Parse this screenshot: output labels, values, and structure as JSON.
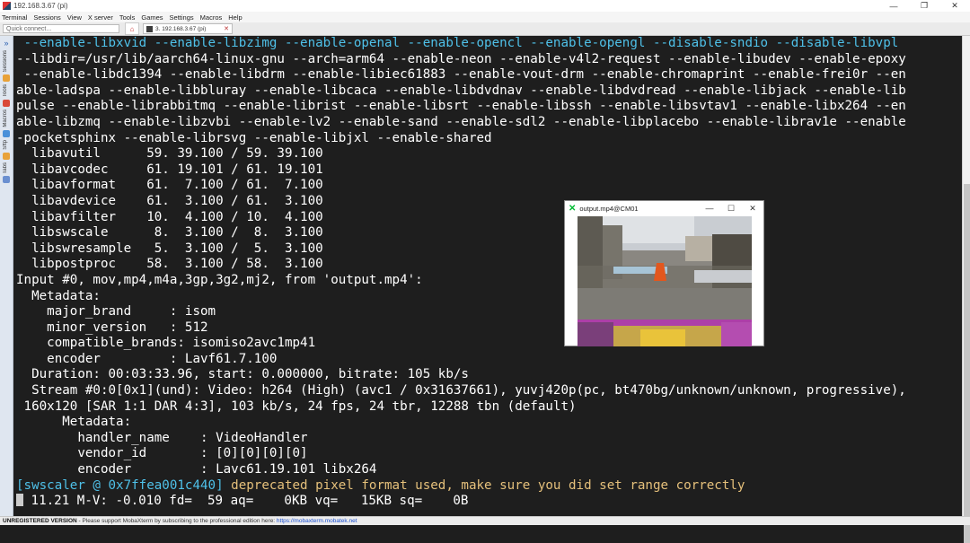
{
  "window": {
    "title": "192.168.3.67 (pi)",
    "controls": [
      "—",
      "❐",
      "✕"
    ]
  },
  "menu": [
    "Terminal",
    "Sessions",
    "View",
    "X server",
    "Tools",
    "Games",
    "Settings",
    "Macros",
    "Help"
  ],
  "quick_connect": {
    "placeholder": "Quick connect..."
  },
  "tab": {
    "label": "3. 192.168.3.67 (pi)",
    "close": "✕"
  },
  "sidebar": [
    "Sessions",
    "Tools",
    "Macros",
    "Sftp",
    "Tabs"
  ],
  "terminal": {
    "lines": [
      [
        {
          "t": " --enable-libxvid --enable-libzimg --enable-openal --enable-opencl --enable-opengl --disable-sndio --disable-libvpl",
          "c": "cyan"
        }
      ],
      [
        {
          "t": "--libdir=/usr/lib/aarch64-linux-gnu --arch=arm64 --enable-neon --enable-v4l2-request --enable-libudev --enable-epoxy",
          "c": ""
        }
      ],
      [
        {
          "t": " --enable-libdc1394 --enable-libdrm --enable-libiec61883 --enable-vout-drm --enable-chromaprint --enable-frei0r --en",
          "c": ""
        }
      ],
      [
        {
          "t": "able-ladspa --enable-libbluray --enable-libcaca --enable-libdvdnav --enable-libdvdread --enable-libjack --enable-lib",
          "c": ""
        }
      ],
      [
        {
          "t": "pulse --enable-librabbitmq --enable-librist --enable-libsrt --enable-libssh --enable-libsvtav1 --enable-libx264 --en",
          "c": ""
        }
      ],
      [
        {
          "t": "able-libzmq --enable-libzvbi --enable-lv2 --enable-sand --enable-sdl2 --enable-libplacebo --enable-librav1e --enable",
          "c": ""
        }
      ],
      [
        {
          "t": "-pocketsphinx --enable-librsvg --enable-libjxl --enable-shared",
          "c": ""
        }
      ],
      [
        {
          "t": "  libavutil      59. 39.100 / 59. 39.100",
          "c": ""
        }
      ],
      [
        {
          "t": "  libavcodec     61. 19.101 / 61. 19.101",
          "c": ""
        }
      ],
      [
        {
          "t": "  libavformat    61.  7.100 / 61.  7.100",
          "c": ""
        }
      ],
      [
        {
          "t": "  libavdevice    61.  3.100 / 61.  3.100",
          "c": ""
        }
      ],
      [
        {
          "t": "  libavfilter    10.  4.100 / 10.  4.100",
          "c": ""
        }
      ],
      [
        {
          "t": "  libswscale      8.  3.100 /  8.  3.100",
          "c": ""
        }
      ],
      [
        {
          "t": "  libswresample   5.  3.100 /  5.  3.100",
          "c": ""
        }
      ],
      [
        {
          "t": "  libpostproc    58.  3.100 / 58.  3.100",
          "c": ""
        }
      ],
      [
        {
          "t": "Input #0, mov,mp4,m4a,3gp,3g2,mj2, from 'output.mp4':",
          "c": ""
        }
      ],
      [
        {
          "t": "  Metadata:",
          "c": ""
        }
      ],
      [
        {
          "t": "    major_brand     : isom",
          "c": ""
        }
      ],
      [
        {
          "t": "    minor_version   : 512",
          "c": ""
        }
      ],
      [
        {
          "t": "    compatible_brands: isomiso2avc1mp41",
          "c": ""
        }
      ],
      [
        {
          "t": "    encoder         : Lavf61.7.100",
          "c": ""
        }
      ],
      [
        {
          "t": "  Duration: 00:03:33.96, start: 0.000000, bitrate: 105 kb/s",
          "c": ""
        }
      ],
      [
        {
          "t": "  Stream #0:0[0x1](und): Video: h264 (High) (avc1 / 0x31637661), yuvj420p(pc, bt470bg/unknown/unknown, progressive),",
          "c": ""
        }
      ],
      [
        {
          "t": " 160x120 [SAR 1:1 DAR 4:3], 103 kb/s, 24 fps, 24 tbr, 12288 tbn (default)",
          "c": ""
        }
      ],
      [
        {
          "t": "      Metadata:",
          "c": ""
        }
      ],
      [
        {
          "t": "        handler_name    : VideoHandler",
          "c": ""
        }
      ],
      [
        {
          "t": "        vendor_id       : [0][0][0][0]",
          "c": ""
        }
      ],
      [
        {
          "t": "        encoder         : Lavc61.19.101 libx264",
          "c": ""
        }
      ],
      [
        {
          "t": "[swscaler @ 0x7ffea001c440]",
          "c": "cyan"
        },
        {
          "t": " deprecated pixel format used, make sure you did set range correctly",
          "c": "yellow"
        }
      ],
      [
        {
          "t": "CURSOR",
          "c": "cursor"
        },
        {
          "t": " 11.21 M-V: -0.010 fd=  59 aq=    0KB vq=   15KB sq=    0B",
          "c": ""
        }
      ]
    ]
  },
  "video_window": {
    "title": "output.mp4@CM01",
    "controls": [
      "—",
      "☐",
      "✕"
    ]
  },
  "status": {
    "bold": "UNREGISTERED VERSION",
    "text": "  -  Please support MobaXterm by subscribing to the professional edition here:  ",
    "link": "https://mobaxterm.mobatek.net"
  }
}
